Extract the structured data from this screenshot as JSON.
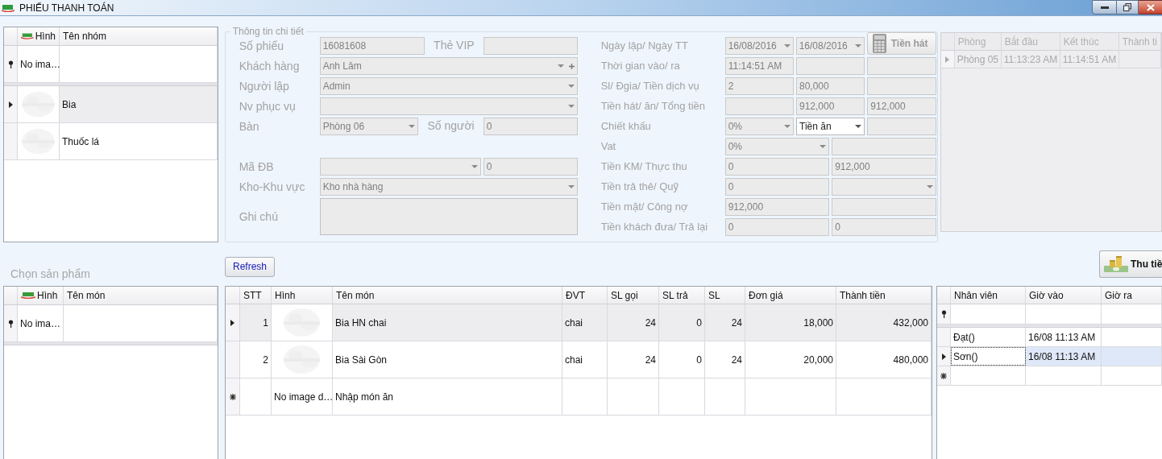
{
  "window": {
    "title": "PHIẾU THANH TOÁN"
  },
  "group_grid": {
    "columns": [
      "Hình",
      "Tên nhóm"
    ],
    "filter_row": {
      "image": "No ima…"
    },
    "rows": [
      {
        "name": "Bia",
        "selected": true
      },
      {
        "name": "Thuốc lá",
        "selected": false
      }
    ]
  },
  "details": {
    "title": "Thông tin chi tiết",
    "left": [
      {
        "label": "Số phiếu",
        "controls": [
          {
            "kind": "text",
            "value": "16081608",
            "disabled": true
          },
          {
            "kind": "label",
            "value": "Thẻ VIP"
          },
          {
            "kind": "text",
            "disabled": true
          }
        ]
      },
      {
        "label": "Khách hàng",
        "controls": [
          {
            "kind": "combo",
            "value": "Anh Lâm",
            "disabled": true,
            "add_button": true
          }
        ]
      },
      {
        "label": "Người lập",
        "controls": [
          {
            "kind": "combo",
            "value": "Admin",
            "disabled": true
          }
        ]
      },
      {
        "label": "Nv phục vụ",
        "controls": [
          {
            "kind": "combo",
            "disabled": true
          }
        ]
      },
      {
        "label": "Bàn",
        "controls": [
          {
            "kind": "combo",
            "value": "Phòng 06",
            "disabled": true
          },
          {
            "kind": "label",
            "value": "Số người"
          },
          {
            "kind": "text",
            "value": "0",
            "disabled": true
          }
        ]
      },
      {
        "label": "Mã ĐB",
        "controls": [
          {
            "kind": "combo",
            "disabled": true
          },
          {
            "kind": "text",
            "value": "0",
            "disabled": true
          }
        ]
      },
      {
        "label": "Kho-Khu vực",
        "controls": [
          {
            "kind": "combo",
            "value": "Kho nhà hàng",
            "disabled": true
          }
        ]
      },
      {
        "label": "Ghi chú",
        "controls": [
          {
            "kind": "memo",
            "disabled": true
          }
        ]
      }
    ],
    "right": [
      {
        "label": "Ngày lập/ Ngày TT",
        "controls": [
          {
            "kind": "combo",
            "value": "16/08/2016",
            "disabled": true
          },
          {
            "kind": "combo",
            "value": "16/08/2016",
            "disabled": true
          },
          {
            "kind": "button",
            "value": "Tiền hát",
            "disabled": true
          }
        ]
      },
      {
        "label": "Thời gian vào/ ra",
        "controls": [
          {
            "kind": "text",
            "value": "11:14:51 AM",
            "disabled": true
          },
          {
            "kind": "text",
            "disabled": true
          },
          {
            "kind": "text",
            "disabled": true
          }
        ]
      },
      {
        "label": "Sl/ Đgia/ Tiền dịch vụ",
        "controls": [
          {
            "kind": "text",
            "value": "2",
            "disabled": true
          },
          {
            "kind": "text",
            "value": "80,000",
            "disabled": true
          },
          {
            "kind": "text",
            "disabled": true
          }
        ]
      },
      {
        "label": "Tiền hát/ ăn/ Tổng tiền",
        "controls": [
          {
            "kind": "text",
            "disabled": true
          },
          {
            "kind": "text",
            "value": "912,000",
            "disabled": true
          },
          {
            "kind": "text",
            "value": "912,000",
            "disabled": true
          }
        ]
      },
      {
        "label": "Chiết khấu",
        "controls": [
          {
            "kind": "combo",
            "value": "0%",
            "disabled": true
          },
          {
            "kind": "combo",
            "value": "Tiền ăn",
            "disabled": false
          },
          {
            "kind": "text",
            "disabled": true
          }
        ]
      },
      {
        "label": "Vat",
        "controls": [
          {
            "kind": "combo",
            "value": "0%",
            "disabled": true
          },
          {
            "kind": "text",
            "disabled": true
          }
        ]
      },
      {
        "label": "Tiền KM/ Thực thu",
        "controls": [
          {
            "kind": "text",
            "value": "0",
            "disabled": true
          },
          {
            "kind": "text",
            "value": "912,000",
            "disabled": true
          }
        ]
      },
      {
        "label": "Tiền trả thẻ/ Quỹ",
        "controls": [
          {
            "kind": "text",
            "value": "0",
            "disabled": true
          },
          {
            "kind": "combo",
            "disabled": true
          }
        ]
      },
      {
        "label": "Tiền mặt/ Công nợ",
        "controls": [
          {
            "kind": "text",
            "value": "912,000",
            "disabled": true
          },
          {
            "kind": "text",
            "disabled": true
          }
        ]
      },
      {
        "label": "Tiền khách đưa/ Trả lại",
        "controls": [
          {
            "kind": "text",
            "value": "0",
            "disabled": true
          },
          {
            "kind": "text",
            "value": "0",
            "disabled": true
          }
        ]
      }
    ]
  },
  "room_grid": {
    "columns": [
      "Phòng",
      "Bắt đầu",
      "Kết thúc",
      "Thành ti"
    ],
    "rows": [
      {
        "room": "Phòng 05",
        "start": "11:13:23 AM",
        "end": "11:14:51 AM"
      }
    ]
  },
  "product_section": {
    "title": "Chọn sản phẩm"
  },
  "product_grid": {
    "columns": [
      "Hình",
      "Tên món"
    ],
    "filter_row": {
      "image": "No ima…"
    }
  },
  "refresh_button": "Refresh",
  "order_grid": {
    "columns": [
      "STT",
      "Hình",
      "Tên món",
      "ĐVT",
      "SL gọi",
      "SL trả",
      "SL",
      "Đơn giá",
      "Thành tiền"
    ],
    "rows": [
      {
        "stt": "1",
        "item": "Bia HN chai",
        "unit": "chai",
        "ordered": "24",
        "returned": "0",
        "qty": "24",
        "price": "18,000",
        "amount": "432,000",
        "selected": true
      },
      {
        "stt": "2",
        "item": "Bia Sài Gòn",
        "unit": "chai",
        "ordered": "24",
        "returned": "0",
        "qty": "24",
        "price": "20,000",
        "amount": "480,000",
        "selected": false
      }
    ],
    "new_row": {
      "image": "No image d…",
      "item": "Nhập món ăn"
    }
  },
  "pay_button": "Thu tiề",
  "staff_grid": {
    "columns": [
      "Nhân viên",
      "Giờ vào",
      "Giờ ra"
    ],
    "rows": [
      {
        "name": "Đạt()",
        "time_in": "16/08 11:13 AM",
        "selected": false
      },
      {
        "name": "Sơn()",
        "time_in": "16/08 11:13 AM",
        "selected": true
      }
    ]
  }
}
